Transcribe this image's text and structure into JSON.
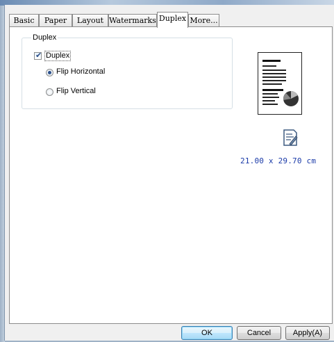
{
  "tabs": [
    {
      "label": "Basic"
    },
    {
      "label": "Paper"
    },
    {
      "label": "Layout"
    },
    {
      "label": "Watermarks"
    },
    {
      "label": "Duplex",
      "active": true
    },
    {
      "label": "More..."
    }
  ],
  "duplex_group": {
    "title": "Duplex",
    "checkbox_label": "Duplex",
    "checkbox_checked": true,
    "options": [
      {
        "label": "Flip Horizontal",
        "checked": true
      },
      {
        "label": "Flip Vertical",
        "checked": false
      }
    ]
  },
  "preview": {
    "icon": "paper-size-icon",
    "size_text": "21.00 x 29.70 cm"
  },
  "buttons": {
    "ok": "OK",
    "cancel": "Cancel",
    "apply": "Apply(A)"
  },
  "colors": {
    "size_text": "#1a3aa8",
    "radio_dot": "#2a4f8c"
  }
}
